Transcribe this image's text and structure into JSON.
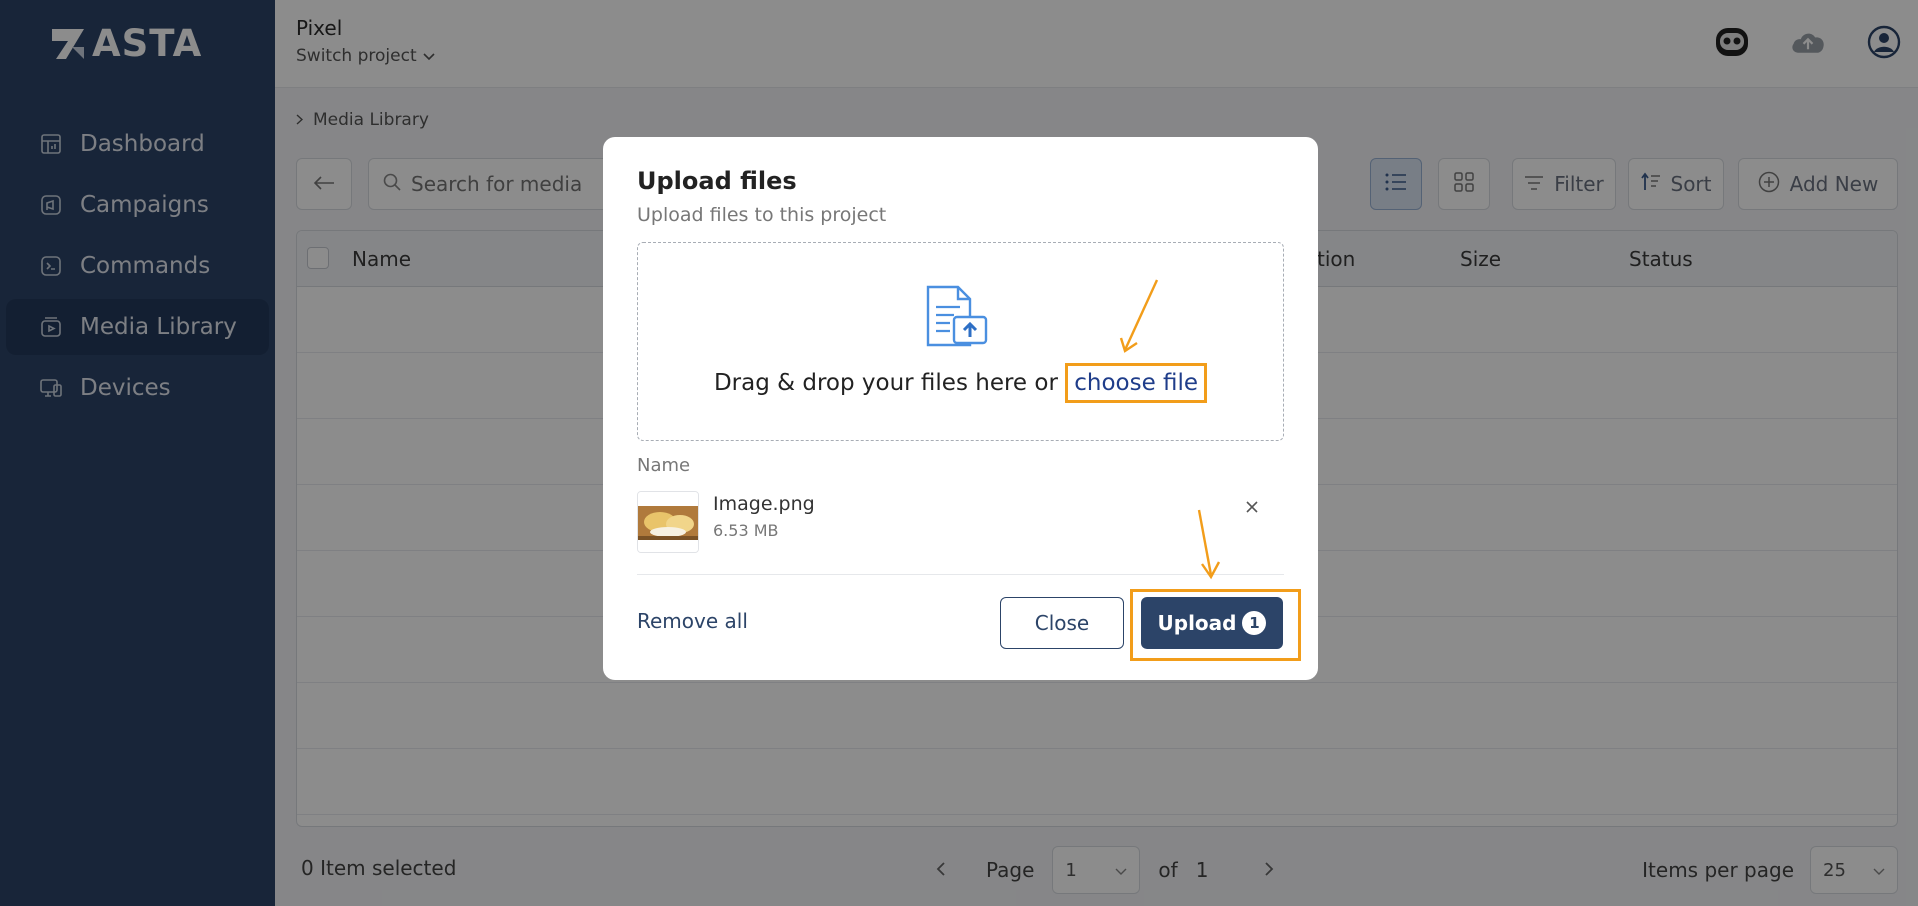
{
  "app": {
    "logo_text": "ASTA"
  },
  "sidebar": {
    "items": [
      {
        "label": "Dashboard",
        "icon": "dashboard-icon"
      },
      {
        "label": "Campaigns",
        "icon": "campaign-icon"
      },
      {
        "label": "Commands",
        "icon": "terminal-icon"
      },
      {
        "label": "Media Library",
        "icon": "media-icon",
        "active": true
      },
      {
        "label": "Devices",
        "icon": "devices-icon"
      }
    ]
  },
  "header": {
    "project_name": "Pixel",
    "switch_project": "Switch project"
  },
  "breadcrumb": {
    "current": "Media Library"
  },
  "toolbar": {
    "search_placeholder": "Search for media",
    "filter_label": "Filter",
    "sort_label": "Sort",
    "add_label": "Add New"
  },
  "table": {
    "columns": [
      "Name",
      "tion",
      "Size",
      "Status"
    ]
  },
  "footer": {
    "selected_text": "0 Item selected",
    "page_label": "Page",
    "page_value": "1",
    "of_label": "of",
    "total_pages": "1",
    "items_per_page_label": "Items per page",
    "items_per_page_value": "25"
  },
  "modal": {
    "title": "Upload files",
    "subtitle": "Upload files to this project",
    "dropzone_text": "Drag & drop your files here or",
    "choose_file": "choose file",
    "files_column_label": "Name",
    "files": [
      {
        "name": "Image.png",
        "size": "6.53 MB"
      }
    ],
    "remove_all": "Remove all",
    "close_label": "Close",
    "upload_label": "Upload",
    "upload_count": "1"
  },
  "colors": {
    "sidebar_bg": "#2c4468",
    "accent": "#2c4468",
    "link": "#1f3d8a",
    "highlight": "#f29d1a"
  }
}
